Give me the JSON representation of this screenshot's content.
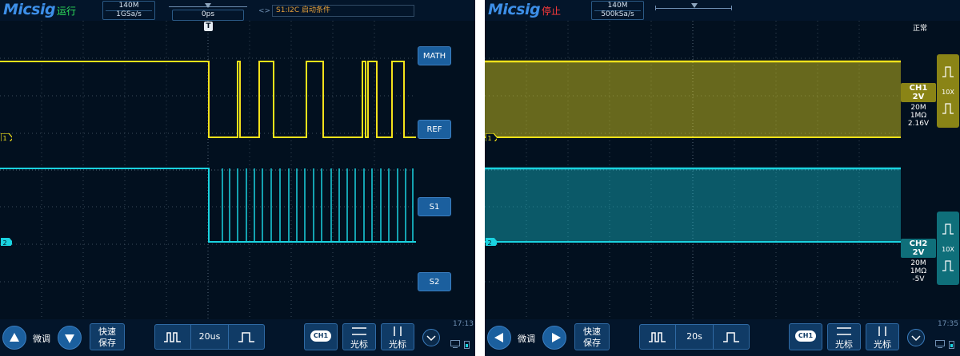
{
  "left_scope": {
    "brand": "Micsig",
    "run_state": "运行",
    "run_state_color": "#2ee05a",
    "memory_depth": "140M",
    "sample_rate": "1GSa/s",
    "trigger_position": "0ps",
    "trigger_condition": "S1:I2C 启动条件",
    "trigger_marker": "T",
    "side_buttons": [
      "MATH",
      "REF",
      "S1",
      "S2"
    ],
    "channel_markers": [
      "1",
      "2"
    ],
    "bottom": {
      "fine_label": "微调",
      "quick_save_line1": "快速",
      "quick_save_line2": "保存",
      "timebase": "20us",
      "ch_button": "CH1",
      "cursor1": "光标",
      "cursor2": "光标"
    },
    "clock": "17:13"
  },
  "right_scope": {
    "brand": "Micsig",
    "run_state": "停止",
    "run_state_color": "#ff3b3b",
    "memory_depth": "140M",
    "sample_rate": "500kSa/s",
    "status": "正常",
    "channel_markers": [
      "1",
      "2"
    ],
    "ch1": {
      "name": "CH1",
      "scale": "2V",
      "bandwidth": "20M",
      "impedance": "1MΩ",
      "offset": "2.16V",
      "probe": "10X",
      "color": "#f2e21a"
    },
    "ch2": {
      "name": "CH2",
      "scale": "2V",
      "bandwidth": "20M",
      "impedance": "1MΩ",
      "offset": "-5V",
      "probe": "10X",
      "color": "#1ad3e0"
    },
    "bottom": {
      "fine_label": "微调",
      "quick_save_line1": "快速",
      "quick_save_line2": "保存",
      "timebase": "20s",
      "ch_button": "CH1",
      "cursor1": "光标",
      "cursor2": "光标"
    },
    "clock": "17:35"
  },
  "colors": {
    "ch1": "#f2e21a",
    "ch2": "#1ad3e0",
    "button_blue": "#1b5f9e"
  },
  "icons": [
    "pulse-icon",
    "edge-icon",
    "cursor-h-icon",
    "cursor-v-icon",
    "chevron-down-icon",
    "display-icon",
    "battery-icon"
  ]
}
